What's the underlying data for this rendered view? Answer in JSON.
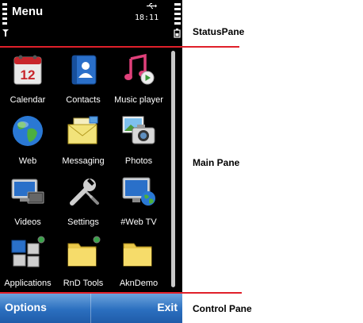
{
  "status_pane": {
    "title": "Menu",
    "time": "18:11"
  },
  "main_pane": {
    "items": [
      {
        "label": "Calendar",
        "icon": "calendar-icon"
      },
      {
        "label": "Contacts",
        "icon": "contacts-icon"
      },
      {
        "label": "Music player",
        "icon": "music-player-icon"
      },
      {
        "label": "Web",
        "icon": "globe-icon"
      },
      {
        "label": "Messaging",
        "icon": "envelope-icon"
      },
      {
        "label": "Photos",
        "icon": "camera-icon"
      },
      {
        "label": "Videos",
        "icon": "video-monitor-icon"
      },
      {
        "label": "Settings",
        "icon": "wrench-icon"
      },
      {
        "label": "#Web TV",
        "icon": "web-tv-icon"
      },
      {
        "label": "Applications",
        "icon": "applications-icon"
      },
      {
        "label": "RnD Tools",
        "icon": "folder-icon"
      },
      {
        "label": "AknDemo",
        "icon": "folder-icon"
      }
    ]
  },
  "control_pane": {
    "left_softkey": "Options",
    "right_softkey": "Exit"
  },
  "annotations": {
    "status_pane": "StatusPane",
    "main_pane": "Main Pane",
    "control_pane": "Control Pane"
  },
  "colors": {
    "background": "#000000",
    "softkey_bar": "#2b6fbf",
    "annotation_line": "#e0202a"
  }
}
